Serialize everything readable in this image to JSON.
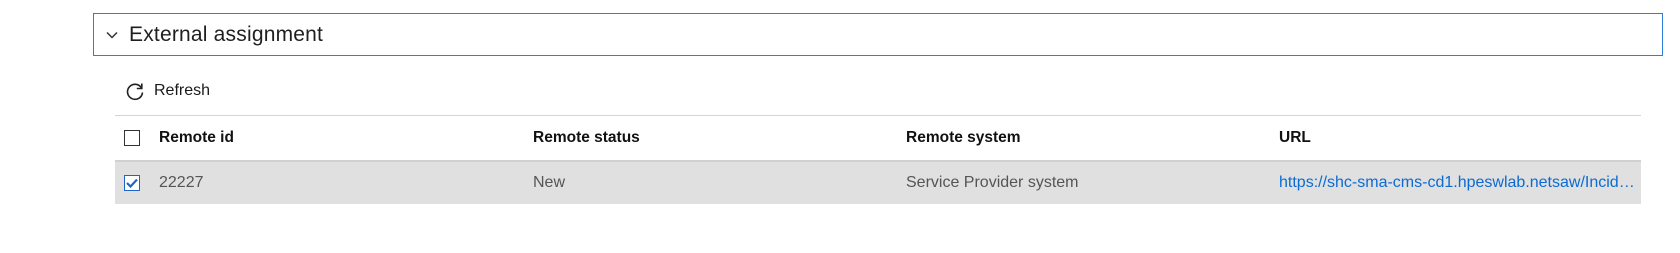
{
  "section": {
    "title": "External assignment",
    "expanded": true
  },
  "toolbar": {
    "refresh_label": "Refresh"
  },
  "table": {
    "columns": [
      "Remote id",
      "Remote status",
      "Remote system",
      "URL"
    ],
    "rows": [
      {
        "selected": true,
        "remote_id": "22227",
        "remote_status": "New",
        "remote_system": "Service Provider system",
        "url": "https://shc-sma-cms-cd1.hpeswlab.netsaw/Incide..."
      }
    ]
  },
  "colors": {
    "accent": "#2d7fd9",
    "link": "#0b6bd3",
    "selected_row_bg": "#e0e0e0"
  },
  "icons": {
    "collapse": "chevron-down-icon",
    "refresh": "refresh-icon",
    "checked": "checkmark-icon"
  }
}
